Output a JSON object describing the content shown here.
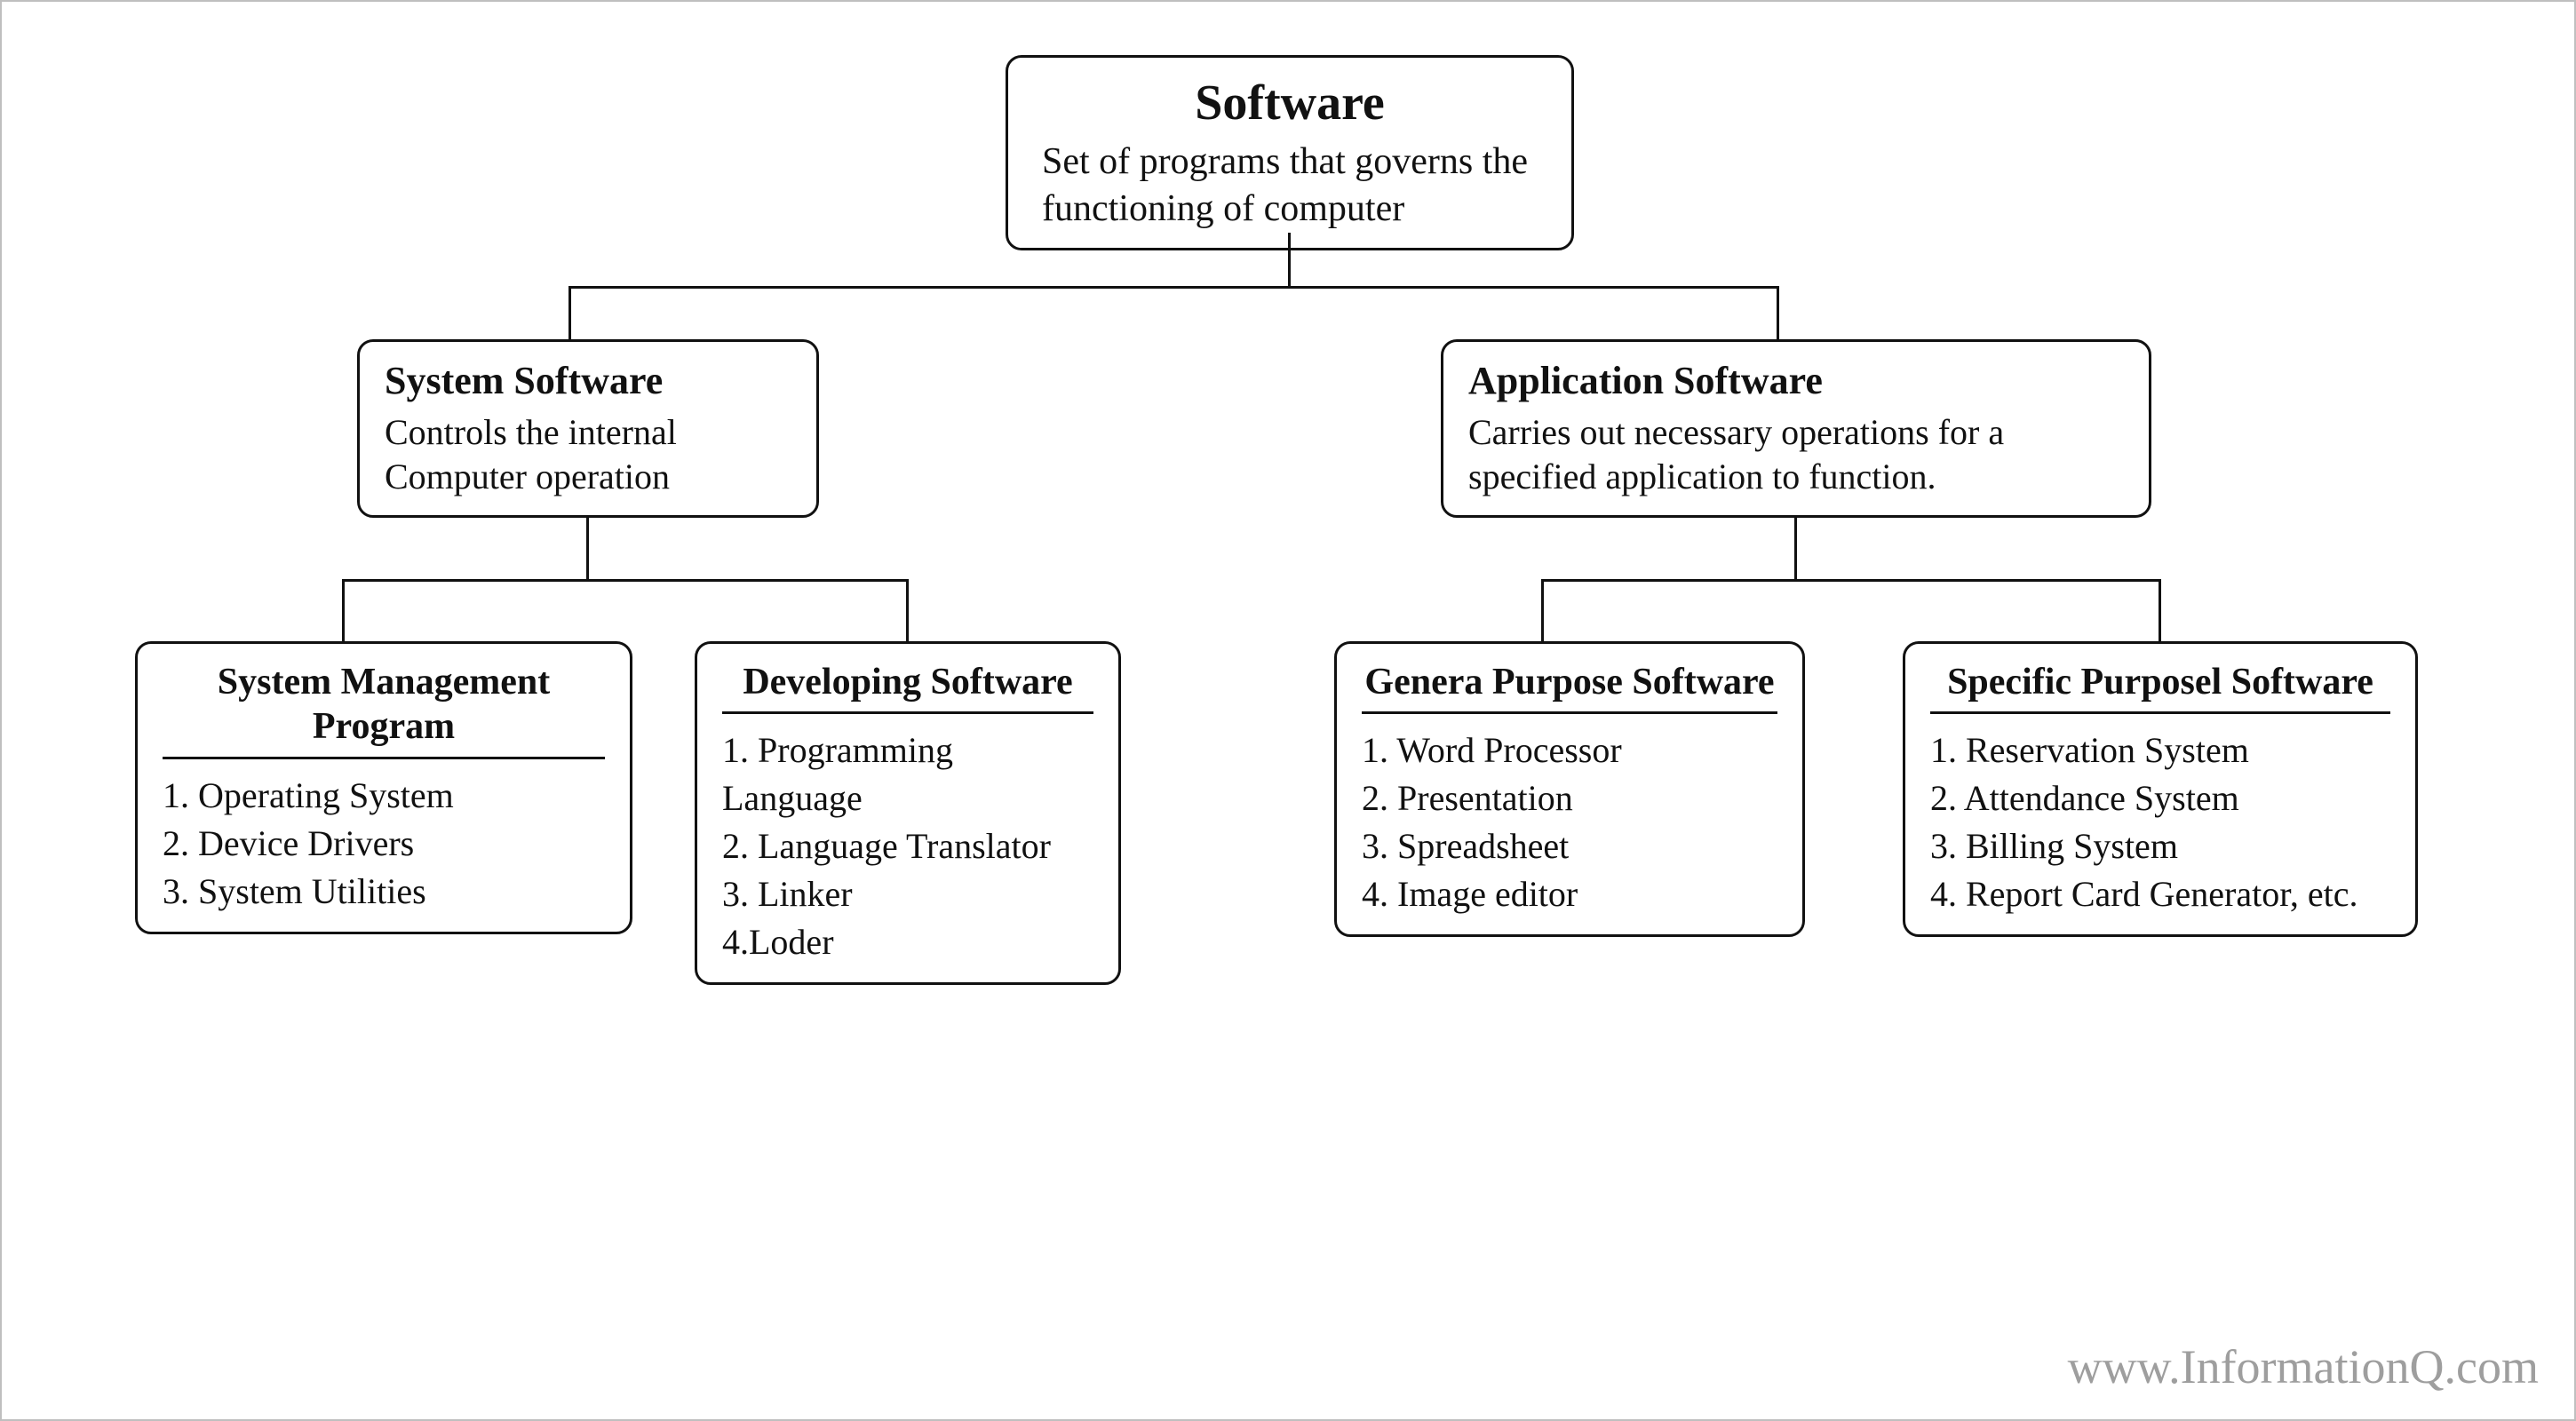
{
  "root": {
    "title": "Software",
    "desc": "Set of programs that governs the  functioning of computer"
  },
  "system": {
    "title": "System Software",
    "desc": "Controls the internal Computer operation"
  },
  "application": {
    "title": "Application Software",
    "desc": "Carries out necessary operations for a specified application to function."
  },
  "sys_mgmt": {
    "title": "System Management Program",
    "items": [
      "1. Operating System",
      "2. Device Drivers",
      "3. System Utilities"
    ]
  },
  "dev_soft": {
    "title": "Developing Software",
    "items": [
      "1. Programming Language",
      "2. Language Translator",
      "3. Linker",
      "4.Loder"
    ]
  },
  "general": {
    "title": "Genera Purpose Software",
    "items": [
      "1. Word Processor",
      "2. Presentation",
      "3. Spreadsheet",
      "4. Image editor"
    ]
  },
  "specific": {
    "title": "Specific Purposel Software",
    "items": [
      "1. Reservation System",
      "2. Attendance System",
      "3. Billing System",
      "4. Report Card Generator, etc."
    ]
  },
  "watermark": "www.InformationQ.com"
}
